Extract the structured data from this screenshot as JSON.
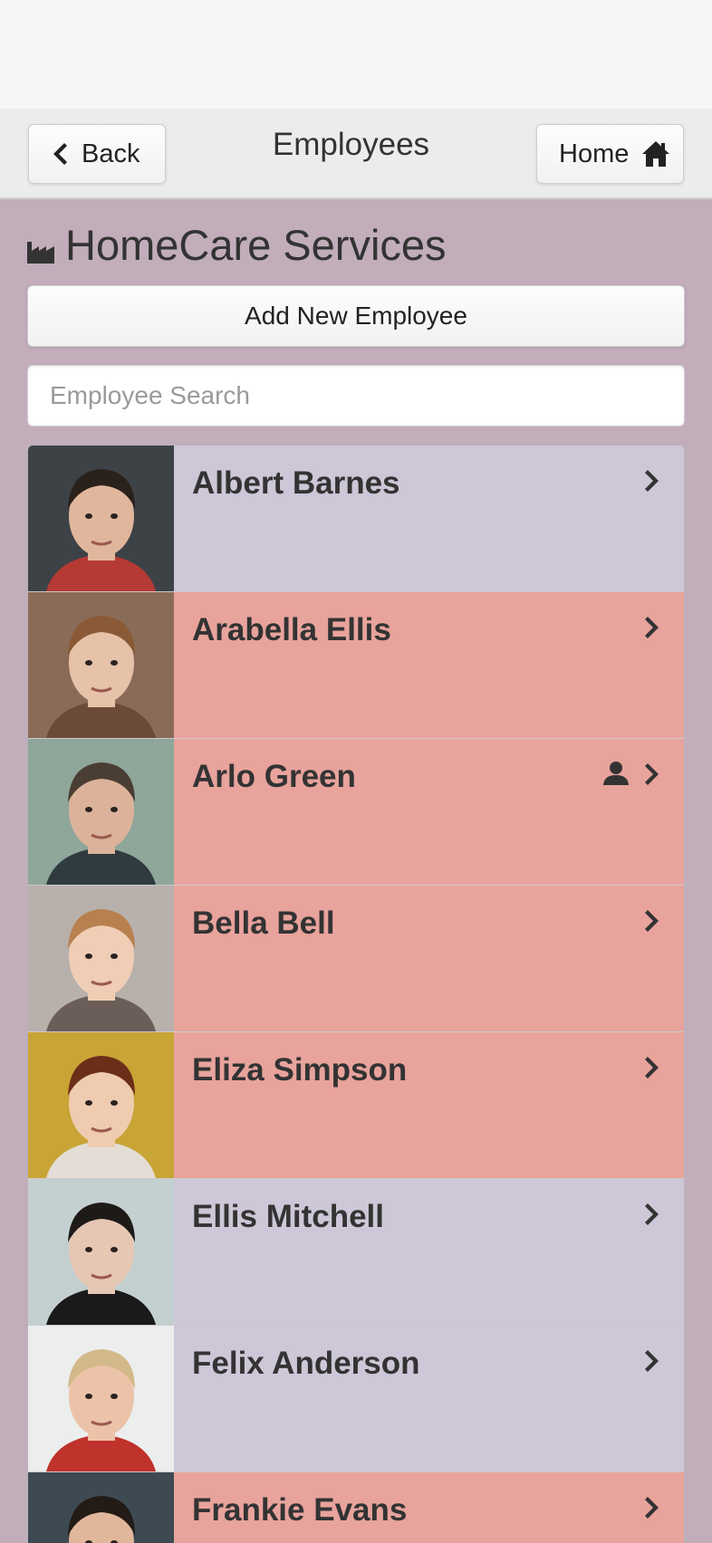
{
  "header": {
    "back_label": "Back",
    "title": "Employees",
    "home_label": "Home"
  },
  "org": {
    "name": "HomeCare Services",
    "icon": "factory-icon"
  },
  "actions": {
    "add_label": "Add New Employee"
  },
  "search": {
    "placeholder": "Employee Search",
    "value": ""
  },
  "colors": {
    "page_bg": "#c2adbb",
    "row_normal": "#cdc7d7",
    "row_alert": "#e8a39c"
  },
  "employees": [
    {
      "name": "Albert Barnes",
      "status": "normal",
      "has_user_icon": false
    },
    {
      "name": "Arabella Ellis",
      "status": "alert",
      "has_user_icon": false
    },
    {
      "name": "Arlo Green",
      "status": "alert",
      "has_user_icon": true
    },
    {
      "name": "Bella Bell",
      "status": "alert",
      "has_user_icon": false
    },
    {
      "name": "Eliza Simpson",
      "status": "alert",
      "has_user_icon": false
    },
    {
      "name": "Ellis Mitchell",
      "status": "normal",
      "has_user_icon": false
    },
    {
      "name": "Felix Anderson",
      "status": "normal",
      "has_user_icon": false
    },
    {
      "name": "Frankie Evans",
      "status": "alert",
      "has_user_icon": false
    }
  ]
}
